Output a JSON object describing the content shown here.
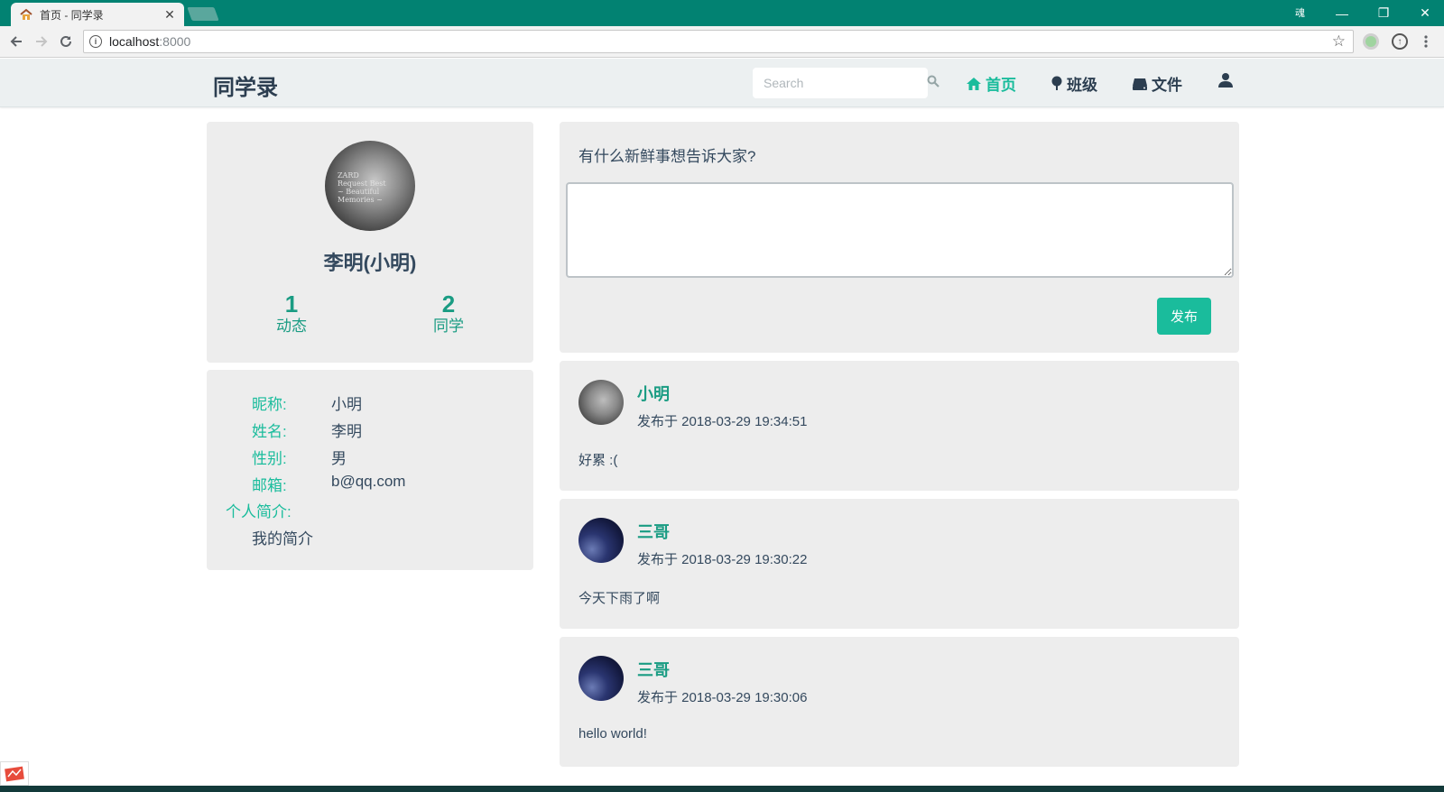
{
  "browser": {
    "tab_title": "首页 - 同学录",
    "tab_close": "✕",
    "url_host": "localhost",
    "url_port": ":8000",
    "window_extra": "魂",
    "minimize": "—",
    "restore": "❐",
    "close": "✕"
  },
  "nav": {
    "brand": "同学录",
    "search_placeholder": "Search",
    "links": [
      {
        "label": "首页",
        "icon": "home-icon",
        "active": true
      },
      {
        "label": "班级",
        "icon": "tree-icon",
        "active": false
      },
      {
        "label": "文件",
        "icon": "hdd-icon",
        "active": false
      },
      {
        "label": "",
        "icon": "user-icon",
        "active": false
      }
    ]
  },
  "profile": {
    "avatar_text": [
      "ZARD",
      "Request Best",
      "~ Beautiful",
      "Memories ~"
    ],
    "name": "李明(小明)",
    "stats": [
      {
        "value": "1",
        "label": "动态"
      },
      {
        "value": "2",
        "label": "同学"
      }
    ]
  },
  "info": {
    "nickname_key": "昵称:",
    "nickname": "小明",
    "realname_key": "姓名:",
    "realname": "李明",
    "gender_key": "性别:",
    "gender": "男",
    "email_key": "邮箱:",
    "email": "b@qq.com",
    "bio_key": "个人简介:",
    "bio": "我的简介"
  },
  "composer": {
    "prompt": "有什么新鲜事想告诉大家?",
    "textarea_value": "",
    "publish_label": "发布"
  },
  "posts": [
    {
      "author": "小明",
      "time": "发布于 2018-03-29 19:34:51",
      "body": "好累 :(",
      "avatar": "gray"
    },
    {
      "author": "三哥",
      "time": "发布于 2018-03-29 19:30:22",
      "body": "今天下雨了啊",
      "avatar": "night"
    },
    {
      "author": "三哥",
      "time": "发布于 2018-03-29 19:30:06",
      "body": "hello world!",
      "avatar": "night"
    }
  ],
  "colors": {
    "accent": "#1abc9c",
    "accent_dark": "#1a9c83",
    "text": "#2c3e50",
    "panel": "#ededed",
    "chrome_frame": "#028272"
  }
}
